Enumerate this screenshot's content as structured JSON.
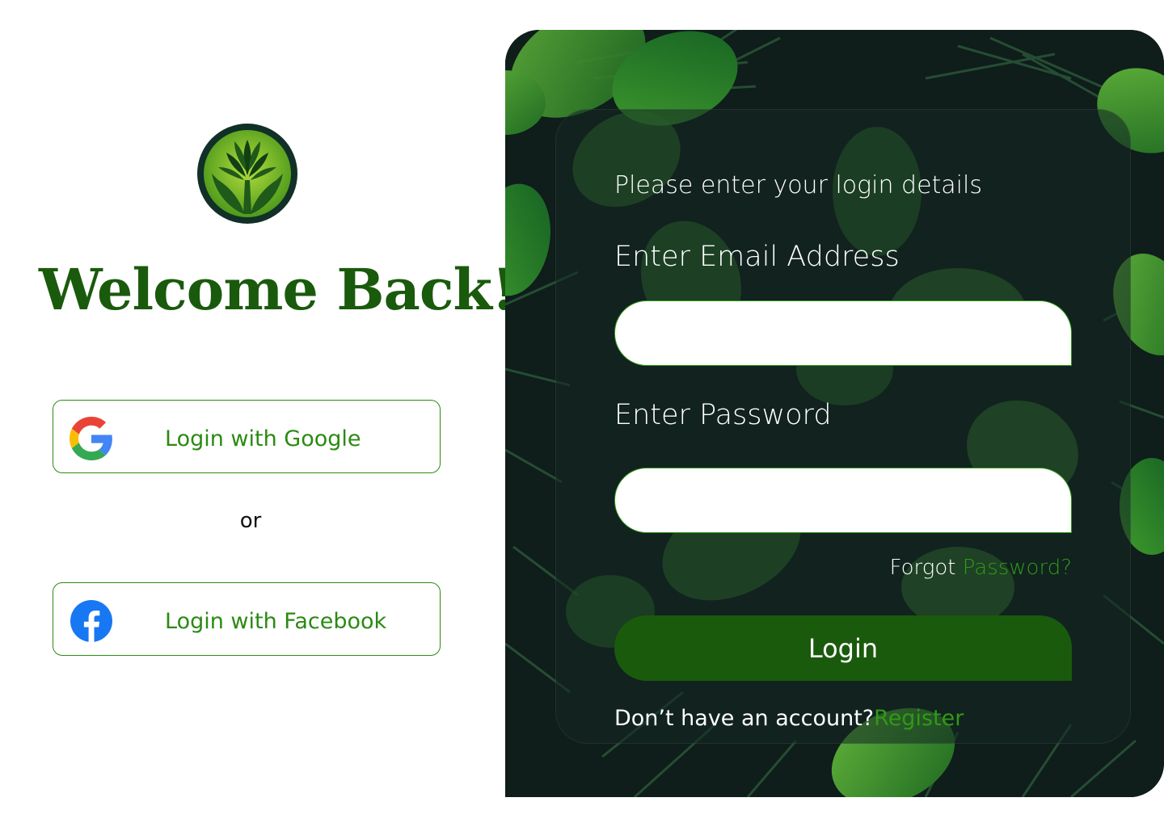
{
  "left": {
    "logo_icon": "tree-in-hands-icon",
    "welcome_title": "Welcome Back!",
    "google_button": {
      "label": "Login with Google",
      "icon": "google-icon"
    },
    "or_text": "or",
    "facebook_button": {
      "label": "Login with Facebook",
      "icon": "facebook-icon"
    }
  },
  "form": {
    "intro": "Please enter your login details",
    "email_label": "Enter Email Address",
    "email_value": "",
    "password_label": "Enter Password",
    "password_value": "",
    "forgot_prefix": "Forgot ",
    "forgot_link": "Password?",
    "login_label": "Login",
    "register_prefix": "Don’t have an account?",
    "register_link": "Register"
  },
  "colors": {
    "brand_green": "#1a5a0c",
    "accent_green": "#2f9a16",
    "panel_dark": "#0e1c1a",
    "white": "#ffffff"
  }
}
